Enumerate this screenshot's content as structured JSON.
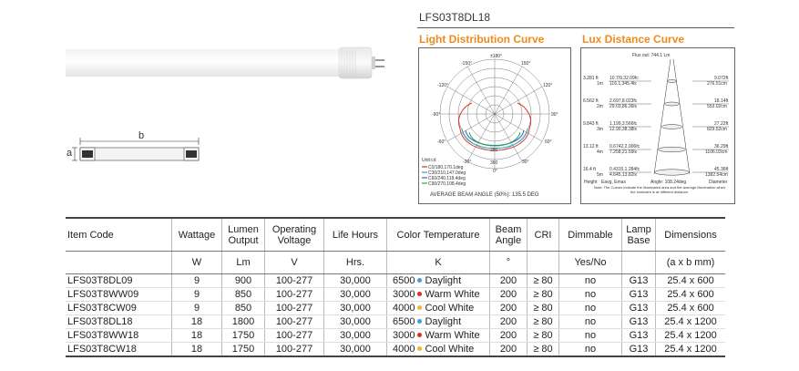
{
  "model": "LFS03T8DL18",
  "light_distribution": {
    "title": "Light Distribution Curve",
    "angle_labels": [
      "±180°",
      "-150°",
      "150°",
      "-120°",
      "120°",
      "-90°",
      "90°",
      "-60°",
      "60°",
      "-30°",
      "30°",
      "0°"
    ],
    "ring_labels": [
      "360",
      "280"
    ],
    "unit": "Unit:cd",
    "legend": [
      "C0/180,170.1deg",
      "C30/210,147.0deg",
      "C60/240,118.4deg",
      "C90/270,108.4deg"
    ],
    "legend_colors": [
      "#e0332a",
      "#2aa7b8",
      "#3a63c9",
      "#28a84a"
    ],
    "beam_angle_note": "AVERAGE BEAM ANGLE (50%): 135.5 DEG"
  },
  "lux_distance": {
    "title": "Lux Distance Curve",
    "flux": "Flux out: 744.1 Lm",
    "rows": [
      {
        "h1": "3.281 ft",
        "h2": "1m",
        "c1": "10.7/9.32.09fc",
        "c2": "116.1,345.4lx",
        "d1": "9.072ft",
        "d2": "276.51cm"
      },
      {
        "h1": "6.562 ft",
        "h2": "2m",
        "c1": "2.697,8.023fc",
        "c2": "29.03,86.36lx",
        "d1": "18.14ft",
        "d2": "553.02cm"
      },
      {
        "h1": "9.843 ft",
        "h2": "3m",
        "c1": "1.199,3.566fc",
        "c2": "12.90,38.38lx",
        "d1": "27.22ft",
        "d2": "829.52cm"
      },
      {
        "h1": "13.12 ft",
        "h2": "4m",
        "c1": "0.6742,2.006fc",
        "c2": "7.258,21.59lx",
        "d1": "36.29ft",
        "d2": "1106.03cm"
      },
      {
        "h1": "16.4 ft",
        "h2": "5m",
        "c1": "0.4315,1.284fc",
        "c2": "4.645,13.82lx",
        "d1": "45.36ft",
        "d2": "1382.54cm"
      }
    ],
    "footer_labels": [
      "Height",
      "Eavg, Emax",
      "Angle: 108.24deg",
      "Diameter"
    ],
    "note": "Note: The Curves indicate the illuminated area and the average illumination when the luminaire is at different distance."
  },
  "dimension_label_a": "a",
  "dimension_label_b": "b",
  "table": {
    "headers": [
      "Item Code",
      "Wattage",
      "Lumen Output",
      "Operating Voltage",
      "Life Hours",
      "Color Temperature",
      "Beam Angle",
      "CRI",
      "Dimmable",
      "Lamp Base",
      "Dimensions"
    ],
    "units": [
      "",
      "W",
      "Lm",
      "V",
      "Hrs.",
      "K",
      "°",
      "",
      "Yes/No",
      "",
      "(a x b mm)"
    ],
    "rows": [
      {
        "code": "LFS03T8DL09",
        "watt": "9",
        "lumen": "900",
        "volt": "100-277",
        "life": "30,000",
        "cct": "6500",
        "cct_name": "Daylight",
        "cct_color": "#3b9fd8",
        "beam": "200",
        "cri": "≥ 80",
        "dim": "no",
        "base": "G13",
        "size": "25.4 x 600"
      },
      {
        "code": "LFS03T8WW09",
        "watt": "9",
        "lumen": "850",
        "volt": "100-277",
        "life": "30,000",
        "cct": "3000",
        "cct_name": "Warm White",
        "cct_color": "#d9302b",
        "beam": "200",
        "cri": "≥ 80",
        "dim": "no",
        "base": "G13",
        "size": "25.4 x 600"
      },
      {
        "code": "LFS03T8CW09",
        "watt": "9",
        "lumen": "850",
        "volt": "100-277",
        "life": "30,000",
        "cct": "4000",
        "cct_name": "Cool White",
        "cct_color": "#f0b62a",
        "beam": "200",
        "cri": "≥ 80",
        "dim": "no",
        "base": "G13",
        "size": "25.4 x 600"
      },
      {
        "code": "LFS03T8DL18",
        "watt": "18",
        "lumen": "1800",
        "volt": "100-277",
        "life": "30,000",
        "cct": "6500",
        "cct_name": "Daylight",
        "cct_color": "#3b9fd8",
        "beam": "200",
        "cri": "≥ 80",
        "dim": "no",
        "base": "G13",
        "size": "25.4 x 1200"
      },
      {
        "code": "LFS03T8WW18",
        "watt": "18",
        "lumen": "1750",
        "volt": "100-277",
        "life": "30,000",
        "cct": "3000",
        "cct_name": "Warm White",
        "cct_color": "#d9302b",
        "beam": "200",
        "cri": "≥ 80",
        "dim": "no",
        "base": "G13",
        "size": "25.4 x 1200"
      },
      {
        "code": "LFS03T8CW18",
        "watt": "18",
        "lumen": "1750",
        "volt": "100-277",
        "life": "30,000",
        "cct": "4000",
        "cct_name": "Cool White",
        "cct_color": "#f0b62a",
        "beam": "200",
        "cri": "≥ 80",
        "dim": "no",
        "base": "G13",
        "size": "25.4 x 1200"
      }
    ]
  }
}
